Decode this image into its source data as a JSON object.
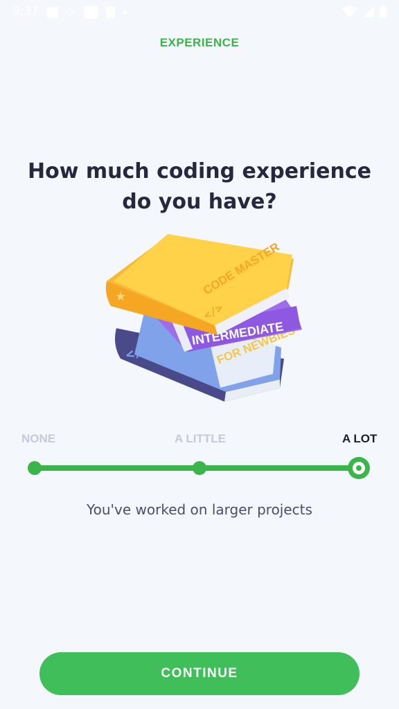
{
  "status_bar": {
    "time": "9:37",
    "icons_left": [
      "image-icon",
      "settings-sync-icon",
      "square-app-icon",
      "clipboard-icon",
      "dot-icon"
    ],
    "icons_right": [
      "wifi-icon",
      "signal-icon",
      "battery-icon"
    ]
  },
  "header": {
    "section_label": "EXPERIENCE"
  },
  "question": {
    "line1": "How much coding experience",
    "line2": "do you have?"
  },
  "illustration": {
    "icon": "books-stack-illustration",
    "book_titles": [
      "CODE MASTER",
      "INTERMEDIATE",
      "FOR NEWBIES"
    ]
  },
  "experience_slider": {
    "levels": [
      "NONE",
      "A LITTLE",
      "A LOT"
    ],
    "selected_index": 2,
    "selected_description": "You've worked on larger projects"
  },
  "footer": {
    "continue_label": "CONTINUE"
  },
  "colors": {
    "accent_green": "#3ab54a",
    "text_dark": "#27283d",
    "background": "#f4f7fc"
  }
}
